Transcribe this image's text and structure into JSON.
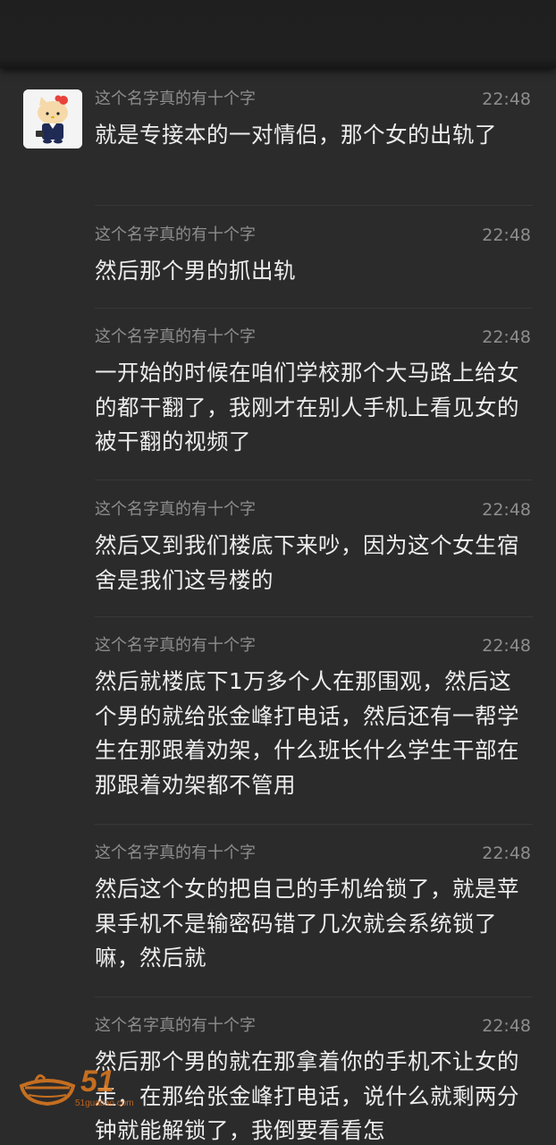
{
  "messages": [
    {
      "sender": "这个名字真的有十个字",
      "time": "22:48",
      "text": "就是专接本的一对情侣，那个女的出轨了"
    },
    {
      "sender": "这个名字真的有十个字",
      "time": "22:48",
      "text": "然后那个男的抓出轨"
    },
    {
      "sender": "这个名字真的有十个字",
      "time": "22:48",
      "text": "一开始的时候在咱们学校那个大马路上给女的都干翻了，我刚才在别人手机上看见女的被干翻的视频了"
    },
    {
      "sender": "这个名字真的有十个字",
      "time": "22:48",
      "text": "然后又到我们楼底下来吵，因为这个女生宿舍是我们这号楼的"
    },
    {
      "sender": "这个名字真的有十个字",
      "time": "22:48",
      "text": "然后就楼底下1万多个人在那围观，然后这个男的就给张金峰打电话，然后还有一帮学生在那跟着劝架，什么班长什么学生干部在那跟着劝架都不管用"
    },
    {
      "sender": "这个名字真的有十个字",
      "time": "22:48",
      "text": "然后这个女的把自己的手机给锁了，就是苹果手机不是输密码错了几次就会系统锁了嘛，然后就"
    },
    {
      "sender": "这个名字真的有十个字",
      "time": "22:48",
      "text": "然后那个男的就在那拿着你的手机不让女的走，在那给张金峰打电话，说什么就剩两分钟就能解锁了，我倒要看看怎"
    }
  ],
  "watermark": {
    "brand": "51",
    "url": "51guatiao.com"
  },
  "colors": {
    "background": "#2b2b2b",
    "text": "#ededed",
    "meta": "#8d8d8d",
    "watermark": "#e07a1f"
  }
}
